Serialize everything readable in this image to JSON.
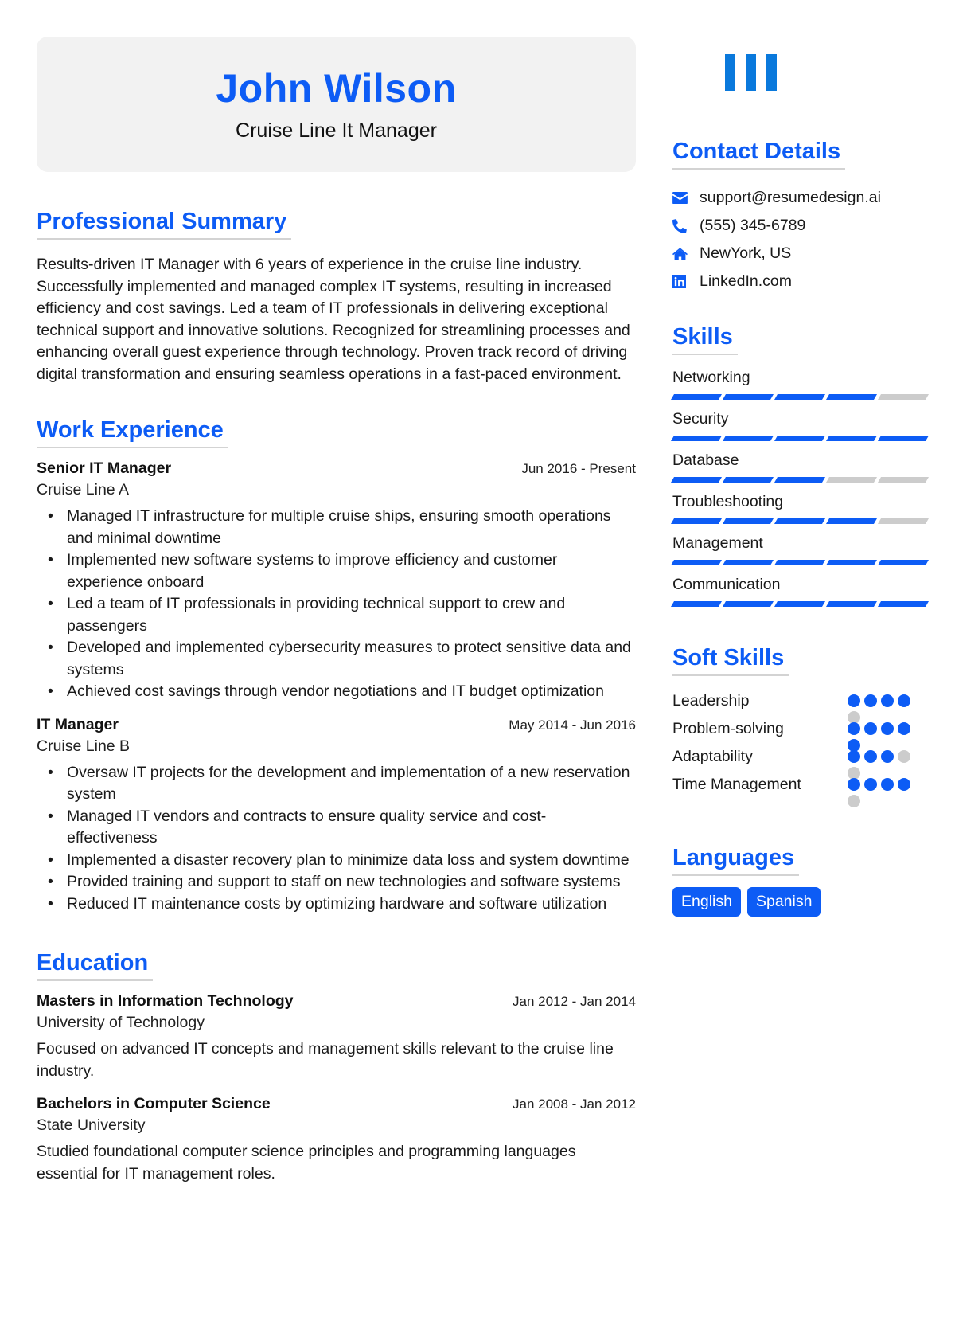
{
  "header": {
    "name": "John Wilson",
    "title": "Cruise Line It Manager"
  },
  "colors": {
    "accent": "#0d5cf5",
    "logo": "#0a79dc",
    "inactive": "#cccccc",
    "header_bg": "#f2f2f2"
  },
  "summary": {
    "heading": "Professional Summary",
    "text": "Results-driven IT Manager with 6 years of experience in the cruise line industry. Successfully implemented and managed complex IT systems, resulting in increased efficiency and cost savings. Led a team of IT professionals in delivering exceptional technical support and innovative solutions. Recognized for streamlining processes and enhancing overall guest experience through technology. Proven track record of driving digital transformation and ensuring seamless operations in a fast-paced environment."
  },
  "work": {
    "heading": "Work Experience",
    "jobs": [
      {
        "title": "Senior IT Manager",
        "dates": "Jun 2016 - Present",
        "company": "Cruise Line A",
        "bullets": [
          "Managed IT infrastructure for multiple cruise ships, ensuring smooth operations and minimal downtime",
          "Implemented new software systems to improve efficiency and customer experience onboard",
          "Led a team of IT professionals in providing technical support to crew and passengers",
          "Developed and implemented cybersecurity measures to protect sensitive data and systems",
          "Achieved cost savings through vendor negotiations and IT budget optimization"
        ]
      },
      {
        "title": "IT Manager",
        "dates": "May 2014 - Jun 2016",
        "company": "Cruise Line B",
        "bullets": [
          "Oversaw IT projects for the development and implementation of a new reservation system",
          "Managed IT vendors and contracts to ensure quality service and cost-effectiveness",
          "Implemented a disaster recovery plan to minimize data loss and system downtime",
          "Provided training and support to staff on new technologies and software systems",
          "Reduced IT maintenance costs by optimizing hardware and software utilization"
        ]
      }
    ]
  },
  "education": {
    "heading": "Education",
    "items": [
      {
        "degree": "Masters in Information Technology",
        "dates": "Jan 2012 - Jan 2014",
        "school": "University of Technology",
        "description": "Focused on advanced IT concepts and management skills relevant to the cruise line industry."
      },
      {
        "degree": "Bachelors in Computer Science",
        "dates": "Jan 2008 - Jan 2012",
        "school": "State University",
        "description": "Studied foundational computer science principles and programming languages essential for IT management roles."
      }
    ]
  },
  "contact": {
    "heading": "Contact Details",
    "items": [
      {
        "icon": "envelope-icon",
        "text": "support@resumedesign.ai"
      },
      {
        "icon": "phone-icon",
        "text": "(555) 345-6789"
      },
      {
        "icon": "home-icon",
        "text": "NewYork, US"
      },
      {
        "icon": "linkedin-icon",
        "text": "LinkedIn.com"
      }
    ]
  },
  "skills": {
    "heading": "Skills",
    "max": 5,
    "items": [
      {
        "name": "Networking",
        "level": 4
      },
      {
        "name": "Security",
        "level": 5
      },
      {
        "name": "Database",
        "level": 3
      },
      {
        "name": "Troubleshooting",
        "level": 4
      },
      {
        "name": "Management",
        "level": 5
      },
      {
        "name": "Communication",
        "level": 5
      }
    ]
  },
  "soft_skills": {
    "heading": "Soft Skills",
    "max": 5,
    "items": [
      {
        "name": "Leadership",
        "level": 4
      },
      {
        "name": "Problem-solving",
        "level": 5
      },
      {
        "name": "Adaptability",
        "level": 3
      },
      {
        "name": "Time Management",
        "level": 4
      }
    ]
  },
  "languages": {
    "heading": "Languages",
    "items": [
      "English",
      "Spanish"
    ]
  }
}
